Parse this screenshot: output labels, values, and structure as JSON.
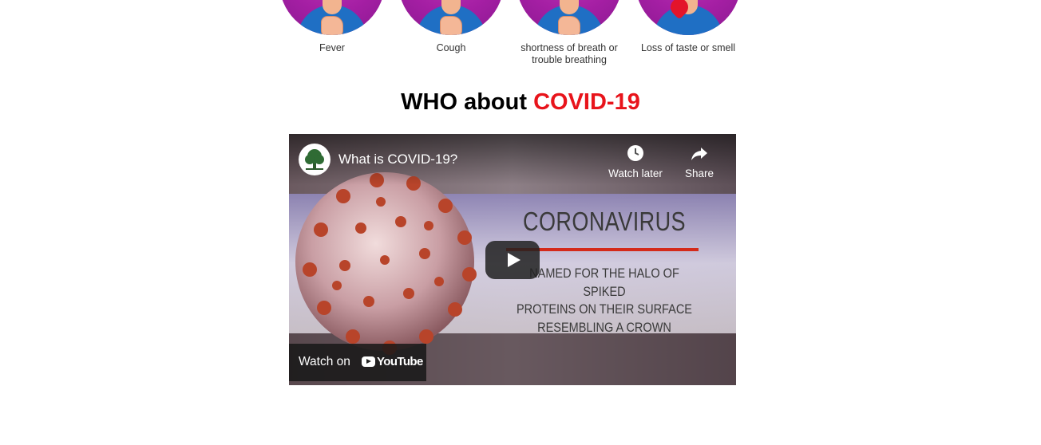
{
  "symptoms": [
    {
      "label": "Fever",
      "icon": "person-fever-icon"
    },
    {
      "label": "Cough",
      "icon": "person-cough-icon"
    },
    {
      "label": "shortness of breath or trouble breathing",
      "icon": "person-breathing-icon"
    },
    {
      "label": "Loss of taste or smell",
      "icon": "person-taste-smell-icon"
    }
  ],
  "section": {
    "heading_prefix": "WHO about",
    "heading_accent": "COVID-19",
    "accent_color": "#e8141b"
  },
  "video": {
    "title": "What is COVID-19?",
    "channel_logo_icon": "who-logo-icon",
    "watch_later_label": "Watch later",
    "share_label": "Share",
    "frame_title": "CORONAVIRUS",
    "frame_subtitle_lines": [
      "NAMED FOR THE HALO OF SPIKED",
      "PROTEINS ON THEIR SURFACE",
      "RESEMBLING A CROWN"
    ],
    "watch_on_label": "Watch on",
    "youtube_label": "YouTube"
  }
}
